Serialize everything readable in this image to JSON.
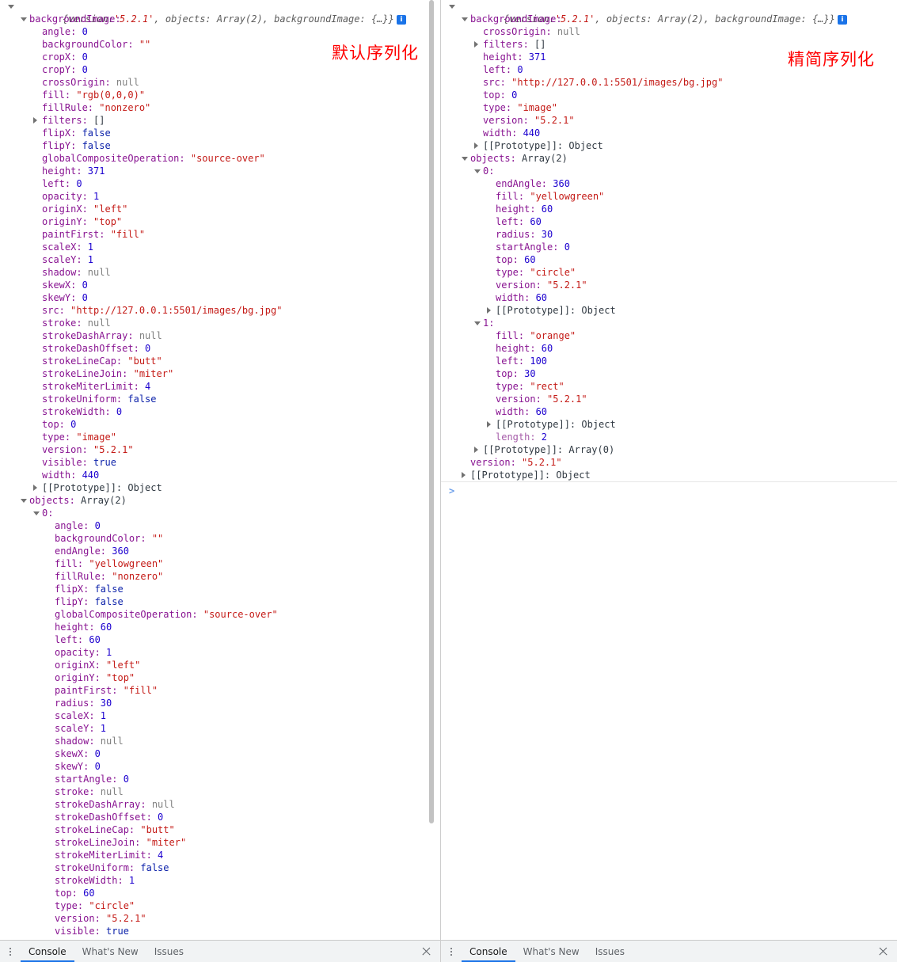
{
  "annotations": {
    "left": "默认序列化",
    "right": "精简序列化",
    "color": "#ff0000"
  },
  "summary_line": {
    "open": "{",
    "version_key": "version:",
    "version_value": "'5.2.1'",
    "objects_key": ", objects:",
    "objects_value": " Array(2)",
    "bg_key": ", backgroundImage:",
    "bg_value": " {…}}",
    "badge": "i"
  },
  "left_panel": {
    "lines": [
      {
        "indent": 1,
        "tri": "open",
        "key": "backgroundImage:",
        "value": "",
        "vtype": ""
      },
      {
        "indent": 2,
        "tri": "",
        "key": "angle:",
        "value": "0",
        "vtype": "num"
      },
      {
        "indent": 2,
        "tri": "",
        "key": "backgroundColor:",
        "value": "\"\"",
        "vtype": "str"
      },
      {
        "indent": 2,
        "tri": "",
        "key": "cropX:",
        "value": "0",
        "vtype": "num"
      },
      {
        "indent": 2,
        "tri": "",
        "key": "cropY:",
        "value": "0",
        "vtype": "num"
      },
      {
        "indent": 2,
        "tri": "",
        "key": "crossOrigin:",
        "value": "null",
        "vtype": "nul"
      },
      {
        "indent": 2,
        "tri": "",
        "key": "fill:",
        "value": "\"rgb(0,0,0)\"",
        "vtype": "str"
      },
      {
        "indent": 2,
        "tri": "",
        "key": "fillRule:",
        "value": "\"nonzero\"",
        "vtype": "str"
      },
      {
        "indent": 2,
        "tri": "closed",
        "key": "filters:",
        "value": "[]",
        "vtype": "plain"
      },
      {
        "indent": 2,
        "tri": "",
        "key": "flipX:",
        "value": "false",
        "vtype": "bool"
      },
      {
        "indent": 2,
        "tri": "",
        "key": "flipY:",
        "value": "false",
        "vtype": "bool"
      },
      {
        "indent": 2,
        "tri": "",
        "key": "globalCompositeOperation:",
        "value": "\"source-over\"",
        "vtype": "str"
      },
      {
        "indent": 2,
        "tri": "",
        "key": "height:",
        "value": "371",
        "vtype": "num"
      },
      {
        "indent": 2,
        "tri": "",
        "key": "left:",
        "value": "0",
        "vtype": "num"
      },
      {
        "indent": 2,
        "tri": "",
        "key": "opacity:",
        "value": "1",
        "vtype": "num"
      },
      {
        "indent": 2,
        "tri": "",
        "key": "originX:",
        "value": "\"left\"",
        "vtype": "str"
      },
      {
        "indent": 2,
        "tri": "",
        "key": "originY:",
        "value": "\"top\"",
        "vtype": "str"
      },
      {
        "indent": 2,
        "tri": "",
        "key": "paintFirst:",
        "value": "\"fill\"",
        "vtype": "str"
      },
      {
        "indent": 2,
        "tri": "",
        "key": "scaleX:",
        "value": "1",
        "vtype": "num"
      },
      {
        "indent": 2,
        "tri": "",
        "key": "scaleY:",
        "value": "1",
        "vtype": "num"
      },
      {
        "indent": 2,
        "tri": "",
        "key": "shadow:",
        "value": "null",
        "vtype": "nul"
      },
      {
        "indent": 2,
        "tri": "",
        "key": "skewX:",
        "value": "0",
        "vtype": "num"
      },
      {
        "indent": 2,
        "tri": "",
        "key": "skewY:",
        "value": "0",
        "vtype": "num"
      },
      {
        "indent": 2,
        "tri": "",
        "key": "src:",
        "value": "\"http://127.0.0.1:5501/images/bg.jpg\"",
        "vtype": "str"
      },
      {
        "indent": 2,
        "tri": "",
        "key": "stroke:",
        "value": "null",
        "vtype": "nul"
      },
      {
        "indent": 2,
        "tri": "",
        "key": "strokeDashArray:",
        "value": "null",
        "vtype": "nul"
      },
      {
        "indent": 2,
        "tri": "",
        "key": "strokeDashOffset:",
        "value": "0",
        "vtype": "num"
      },
      {
        "indent": 2,
        "tri": "",
        "key": "strokeLineCap:",
        "value": "\"butt\"",
        "vtype": "str"
      },
      {
        "indent": 2,
        "tri": "",
        "key": "strokeLineJoin:",
        "value": "\"miter\"",
        "vtype": "str"
      },
      {
        "indent": 2,
        "tri": "",
        "key": "strokeMiterLimit:",
        "value": "4",
        "vtype": "num"
      },
      {
        "indent": 2,
        "tri": "",
        "key": "strokeUniform:",
        "value": "false",
        "vtype": "bool"
      },
      {
        "indent": 2,
        "tri": "",
        "key": "strokeWidth:",
        "value": "0",
        "vtype": "num"
      },
      {
        "indent": 2,
        "tri": "",
        "key": "top:",
        "value": "0",
        "vtype": "num"
      },
      {
        "indent": 2,
        "tri": "",
        "key": "type:",
        "value": "\"image\"",
        "vtype": "str"
      },
      {
        "indent": 2,
        "tri": "",
        "key": "version:",
        "value": "\"5.2.1\"",
        "vtype": "str"
      },
      {
        "indent": 2,
        "tri": "",
        "key": "visible:",
        "value": "true",
        "vtype": "bool"
      },
      {
        "indent": 2,
        "tri": "",
        "key": "width:",
        "value": "440",
        "vtype": "num"
      },
      {
        "indent": 2,
        "tri": "closed",
        "key": "[[Prototype]]:",
        "value": "Object",
        "vtype": "proto",
        "ktype": "proto"
      },
      {
        "indent": 1,
        "tri": "open",
        "key": "objects:",
        "value": "Array(2)",
        "vtype": "plain"
      },
      {
        "indent": 2,
        "tri": "open",
        "key": "0:",
        "value": "",
        "vtype": ""
      },
      {
        "indent": 3,
        "tri": "",
        "key": "angle:",
        "value": "0",
        "vtype": "num"
      },
      {
        "indent": 3,
        "tri": "",
        "key": "backgroundColor:",
        "value": "\"\"",
        "vtype": "str"
      },
      {
        "indent": 3,
        "tri": "",
        "key": "endAngle:",
        "value": "360",
        "vtype": "num"
      },
      {
        "indent": 3,
        "tri": "",
        "key": "fill:",
        "value": "\"yellowgreen\"",
        "vtype": "str"
      },
      {
        "indent": 3,
        "tri": "",
        "key": "fillRule:",
        "value": "\"nonzero\"",
        "vtype": "str"
      },
      {
        "indent": 3,
        "tri": "",
        "key": "flipX:",
        "value": "false",
        "vtype": "bool"
      },
      {
        "indent": 3,
        "tri": "",
        "key": "flipY:",
        "value": "false",
        "vtype": "bool"
      },
      {
        "indent": 3,
        "tri": "",
        "key": "globalCompositeOperation:",
        "value": "\"source-over\"",
        "vtype": "str"
      },
      {
        "indent": 3,
        "tri": "",
        "key": "height:",
        "value": "60",
        "vtype": "num"
      },
      {
        "indent": 3,
        "tri": "",
        "key": "left:",
        "value": "60",
        "vtype": "num"
      },
      {
        "indent": 3,
        "tri": "",
        "key": "opacity:",
        "value": "1",
        "vtype": "num"
      },
      {
        "indent": 3,
        "tri": "",
        "key": "originX:",
        "value": "\"left\"",
        "vtype": "str"
      },
      {
        "indent": 3,
        "tri": "",
        "key": "originY:",
        "value": "\"top\"",
        "vtype": "str"
      },
      {
        "indent": 3,
        "tri": "",
        "key": "paintFirst:",
        "value": "\"fill\"",
        "vtype": "str"
      },
      {
        "indent": 3,
        "tri": "",
        "key": "radius:",
        "value": "30",
        "vtype": "num"
      },
      {
        "indent": 3,
        "tri": "",
        "key": "scaleX:",
        "value": "1",
        "vtype": "num"
      },
      {
        "indent": 3,
        "tri": "",
        "key": "scaleY:",
        "value": "1",
        "vtype": "num"
      },
      {
        "indent": 3,
        "tri": "",
        "key": "shadow:",
        "value": "null",
        "vtype": "nul"
      },
      {
        "indent": 3,
        "tri": "",
        "key": "skewX:",
        "value": "0",
        "vtype": "num"
      },
      {
        "indent": 3,
        "tri": "",
        "key": "skewY:",
        "value": "0",
        "vtype": "num"
      },
      {
        "indent": 3,
        "tri": "",
        "key": "startAngle:",
        "value": "0",
        "vtype": "num"
      },
      {
        "indent": 3,
        "tri": "",
        "key": "stroke:",
        "value": "null",
        "vtype": "nul"
      },
      {
        "indent": 3,
        "tri": "",
        "key": "strokeDashArray:",
        "value": "null",
        "vtype": "nul"
      },
      {
        "indent": 3,
        "tri": "",
        "key": "strokeDashOffset:",
        "value": "0",
        "vtype": "num"
      },
      {
        "indent": 3,
        "tri": "",
        "key": "strokeLineCap:",
        "value": "\"butt\"",
        "vtype": "str"
      },
      {
        "indent": 3,
        "tri": "",
        "key": "strokeLineJoin:",
        "value": "\"miter\"",
        "vtype": "str"
      },
      {
        "indent": 3,
        "tri": "",
        "key": "strokeMiterLimit:",
        "value": "4",
        "vtype": "num"
      },
      {
        "indent": 3,
        "tri": "",
        "key": "strokeUniform:",
        "value": "false",
        "vtype": "bool"
      },
      {
        "indent": 3,
        "tri": "",
        "key": "strokeWidth:",
        "value": "1",
        "vtype": "num"
      },
      {
        "indent": 3,
        "tri": "",
        "key": "top:",
        "value": "60",
        "vtype": "num"
      },
      {
        "indent": 3,
        "tri": "",
        "key": "type:",
        "value": "\"circle\"",
        "vtype": "str"
      },
      {
        "indent": 3,
        "tri": "",
        "key": "version:",
        "value": "\"5.2.1\"",
        "vtype": "str"
      },
      {
        "indent": 3,
        "tri": "",
        "key": "visible:",
        "value": "true",
        "vtype": "bool"
      }
    ]
  },
  "right_panel": {
    "lines": [
      {
        "indent": 1,
        "tri": "open",
        "key": "backgroundImage:",
        "value": "",
        "vtype": ""
      },
      {
        "indent": 2,
        "tri": "",
        "key": "crossOrigin:",
        "value": "null",
        "vtype": "nul"
      },
      {
        "indent": 2,
        "tri": "closed",
        "key": "filters:",
        "value": "[]",
        "vtype": "plain"
      },
      {
        "indent": 2,
        "tri": "",
        "key": "height:",
        "value": "371",
        "vtype": "num"
      },
      {
        "indent": 2,
        "tri": "",
        "key": "left:",
        "value": "0",
        "vtype": "num"
      },
      {
        "indent": 2,
        "tri": "",
        "key": "src:",
        "value": "\"http://127.0.0.1:5501/images/bg.jpg\"",
        "vtype": "str"
      },
      {
        "indent": 2,
        "tri": "",
        "key": "top:",
        "value": "0",
        "vtype": "num"
      },
      {
        "indent": 2,
        "tri": "",
        "key": "type:",
        "value": "\"image\"",
        "vtype": "str"
      },
      {
        "indent": 2,
        "tri": "",
        "key": "version:",
        "value": "\"5.2.1\"",
        "vtype": "str"
      },
      {
        "indent": 2,
        "tri": "",
        "key": "width:",
        "value": "440",
        "vtype": "num"
      },
      {
        "indent": 2,
        "tri": "closed",
        "key": "[[Prototype]]:",
        "value": "Object",
        "vtype": "proto",
        "ktype": "proto"
      },
      {
        "indent": 1,
        "tri": "open",
        "key": "objects:",
        "value": "Array(2)",
        "vtype": "plain"
      },
      {
        "indent": 2,
        "tri": "open",
        "key": "0:",
        "value": "",
        "vtype": ""
      },
      {
        "indent": 3,
        "tri": "",
        "key": "endAngle:",
        "value": "360",
        "vtype": "num"
      },
      {
        "indent": 3,
        "tri": "",
        "key": "fill:",
        "value": "\"yellowgreen\"",
        "vtype": "str"
      },
      {
        "indent": 3,
        "tri": "",
        "key": "height:",
        "value": "60",
        "vtype": "num"
      },
      {
        "indent": 3,
        "tri": "",
        "key": "left:",
        "value": "60",
        "vtype": "num"
      },
      {
        "indent": 3,
        "tri": "",
        "key": "radius:",
        "value": "30",
        "vtype": "num"
      },
      {
        "indent": 3,
        "tri": "",
        "key": "startAngle:",
        "value": "0",
        "vtype": "num"
      },
      {
        "indent": 3,
        "tri": "",
        "key": "top:",
        "value": "60",
        "vtype": "num"
      },
      {
        "indent": 3,
        "tri": "",
        "key": "type:",
        "value": "\"circle\"",
        "vtype": "str"
      },
      {
        "indent": 3,
        "tri": "",
        "key": "version:",
        "value": "\"5.2.1\"",
        "vtype": "str"
      },
      {
        "indent": 3,
        "tri": "",
        "key": "width:",
        "value": "60",
        "vtype": "num"
      },
      {
        "indent": 3,
        "tri": "closed",
        "key": "[[Prototype]]:",
        "value": "Object",
        "vtype": "proto",
        "ktype": "proto"
      },
      {
        "indent": 2,
        "tri": "open",
        "key": "1:",
        "value": "",
        "vtype": ""
      },
      {
        "indent": 3,
        "tri": "",
        "key": "fill:",
        "value": "\"orange\"",
        "vtype": "str"
      },
      {
        "indent": 3,
        "tri": "",
        "key": "height:",
        "value": "60",
        "vtype": "num"
      },
      {
        "indent": 3,
        "tri": "",
        "key": "left:",
        "value": "100",
        "vtype": "num"
      },
      {
        "indent": 3,
        "tri": "",
        "key": "top:",
        "value": "30",
        "vtype": "num"
      },
      {
        "indent": 3,
        "tri": "",
        "key": "type:",
        "value": "\"rect\"",
        "vtype": "str"
      },
      {
        "indent": 3,
        "tri": "",
        "key": "version:",
        "value": "\"5.2.1\"",
        "vtype": "str"
      },
      {
        "indent": 3,
        "tri": "",
        "key": "width:",
        "value": "60",
        "vtype": "num"
      },
      {
        "indent": 3,
        "tri": "closed",
        "key": "[[Prototype]]:",
        "value": "Object",
        "vtype": "proto",
        "ktype": "proto"
      },
      {
        "indent": 3,
        "tri": "",
        "key": "length:",
        "value": "2",
        "vtype": "num",
        "ktype": "dim"
      },
      {
        "indent": 2,
        "tri": "closed",
        "key": "[[Prototype]]:",
        "value": "Array(0)",
        "vtype": "proto",
        "ktype": "proto"
      },
      {
        "indent": 1,
        "tri": "",
        "key": "version:",
        "value": "\"5.2.1\"",
        "vtype": "str"
      },
      {
        "indent": 1,
        "tri": "closed",
        "key": "[[Prototype]]:",
        "value": "Object",
        "vtype": "proto",
        "ktype": "proto"
      }
    ],
    "prompt": ">"
  },
  "drawer": {
    "menu_icon": "kebab-menu-icon",
    "tabs": [
      "Console",
      "What's New",
      "Issues"
    ],
    "active_tab": "Console",
    "close_label": "×",
    "accent": "#1a73e8"
  }
}
